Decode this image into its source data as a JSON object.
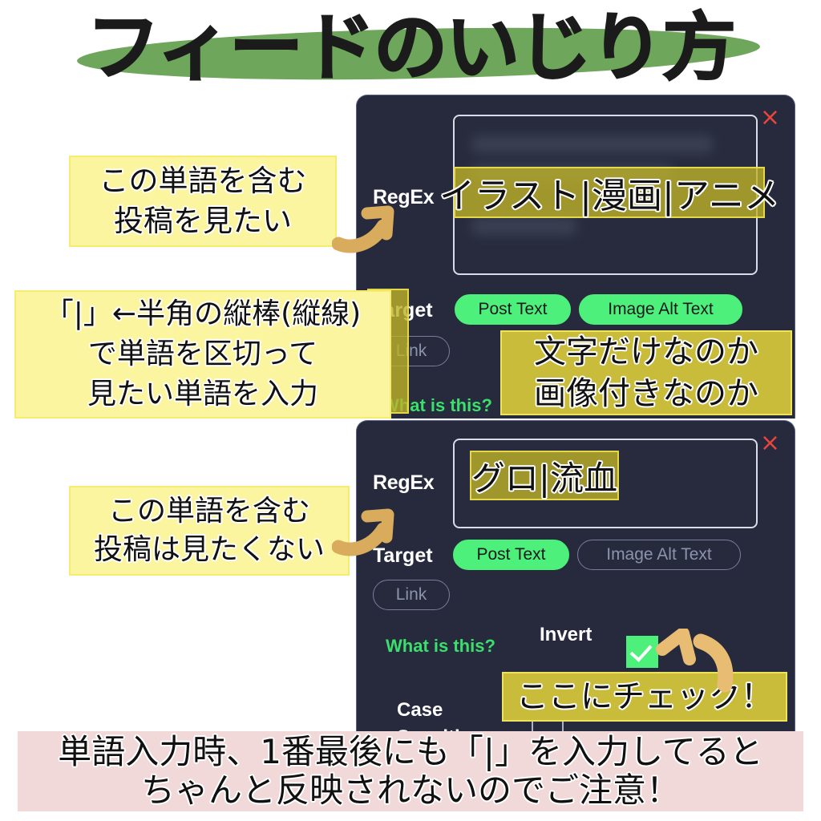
{
  "title": {
    "text": "フィードのいじり方",
    "highlight_color": "#6ea65c"
  },
  "panels": [
    {
      "name": "include-filter-dialog",
      "close_icon": "×",
      "regex_label": "RegEx",
      "regex_value": "イラスト|漫画|アニメ",
      "target_label": "Target",
      "targets": [
        {
          "label": "Post Text",
          "state": "on"
        },
        {
          "label": "Image Alt Text",
          "state": "on"
        },
        {
          "label": "Link",
          "state": "off"
        }
      ],
      "what_is_this": "What is this?"
    },
    {
      "name": "exclude-filter-dialog",
      "close_icon": "×",
      "regex_label": "RegEx",
      "regex_value": "グロ|流血",
      "target_label": "Target",
      "targets": [
        {
          "label": "Post Text",
          "state": "on"
        },
        {
          "label": "Image Alt Text",
          "state": "off"
        },
        {
          "label": "Link",
          "state": "off"
        }
      ],
      "what_is_this": "What is this?",
      "invert_label": "Invert",
      "invert_checked": true,
      "case_label": "Case Sensitive",
      "case_checked": false
    }
  ],
  "annotations": {
    "note1": {
      "line1": "この単語を含む",
      "line2": "投稿を見たい"
    },
    "note2": {
      "line1": "「|」←半角の縦棒(縦線)",
      "line2": "で単語を区切って",
      "line3": "見たい単語を入力"
    },
    "note3": {
      "line1": "文字だけなのか",
      "line2": "画像付きなのか"
    },
    "note4": {
      "line1": "この単語を含む",
      "line2": "投稿は見たくない"
    },
    "note5": {
      "line1": "ここにチェック！"
    }
  },
  "footer": {
    "line1": "単語入力時、1番最後にも「|」を入力してると",
    "line2": "ちゃんと反映されないのでご注意！"
  },
  "colors": {
    "panel_bg": "#262a3c",
    "accent_green": "#4df07a",
    "link_green": "#3bdf6c",
    "close_red": "#e8453c",
    "note_yellow": "#fbf5a0",
    "highlight_olive": "#c8bc3a",
    "arrow_tan": "#d9ab5c",
    "banner_pink": "#f0d9d8"
  }
}
